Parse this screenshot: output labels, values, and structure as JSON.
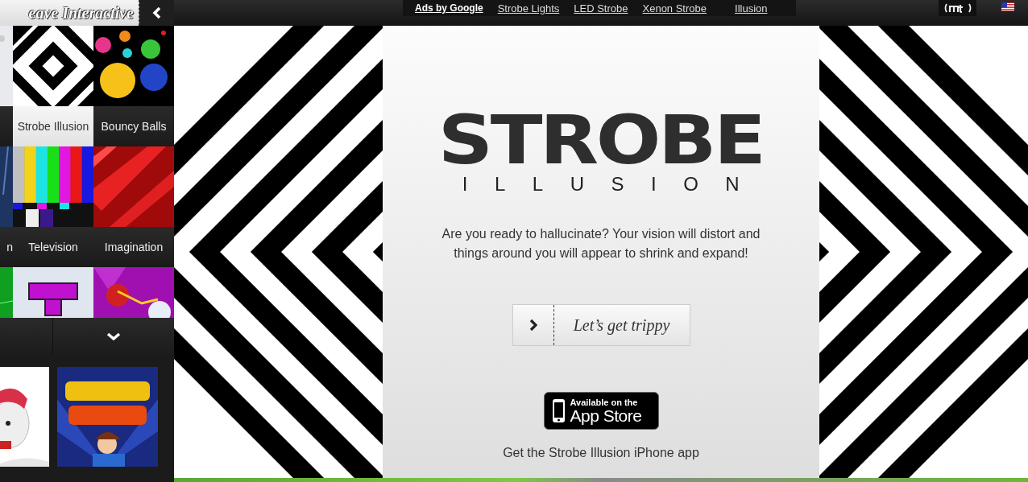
{
  "sidebar": {
    "title": "eave Interactive",
    "tile_rows": [
      {
        "tiles": [
          {
            "label": "Strobe Illusion",
            "selected": true
          },
          {
            "label": "Bouncy Balls",
            "selected": false
          }
        ]
      },
      {
        "edge_label": "n",
        "tiles": [
          {
            "label": "Television",
            "selected": false
          },
          {
            "label": "Imagination",
            "selected": false
          }
        ]
      }
    ]
  },
  "ads_bar": {
    "label": "Ads by Google",
    "links": [
      "Strobe Lights",
      "LED Strobe",
      "Xenon Strobe",
      "Illusion"
    ]
  },
  "main": {
    "logo_title": "STROBE",
    "logo_subtitle": "ILLUSION",
    "intro": "Are you ready to hallucinate? Your vision will distort and things around you will appear to shrink and expand!",
    "cta_button": "Let’s get trippy",
    "app_badge": {
      "line_1": "Available on the",
      "line_2": "App Store"
    },
    "app_text": "Get the Strobe Illusion",
    "app_link": "iPhone app"
  }
}
